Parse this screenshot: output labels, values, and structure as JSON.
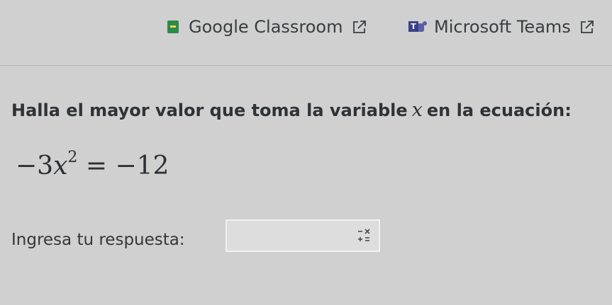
{
  "share": {
    "classroom_label": "Google Classroom",
    "teams_label": "Microsoft Teams",
    "teams_glyph": "T"
  },
  "question": {
    "prefix": "Halla el mayor valor que toma la variable",
    "variable": "x",
    "suffix": "en la ecuación:"
  },
  "equation": {
    "neg_coef": "−3",
    "var": "x",
    "exponent": "2",
    "rhs": "= −12"
  },
  "answer": {
    "label": "Ingresa tu respuesta:",
    "value": ""
  },
  "colors": {
    "background": "#cfd0cf",
    "text": "#2d3033",
    "classroom_green": "#2f8a4c",
    "teams_purple": "#3b3f8a"
  }
}
